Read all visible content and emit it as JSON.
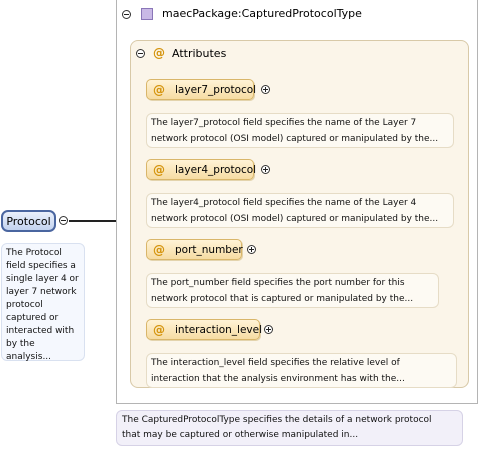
{
  "type": {
    "title": "maecPackage:CapturedProtocolType",
    "description": [
      "The CapturedProtocolType specifies the details of a network protocol",
      "that may be captured or otherwise manipulated in..."
    ]
  },
  "attributes": {
    "title": "Attributes",
    "items": [
      {
        "name": "layer7_protocol",
        "desc": [
          "The layer7_protocol field specifies the name of the Layer 7",
          "network protocol (OSI model) captured or manipulated by the..."
        ]
      },
      {
        "name": "layer4_protocol",
        "desc": [
          "The layer4_protocol field specifies the name of the Layer 4",
          "network protocol (OSI model) captured or manipulated by the..."
        ]
      },
      {
        "name": "port_number",
        "desc": [
          "The port_number field specifies the port number for this",
          "network protocol that is captured or manipulated by the..."
        ]
      },
      {
        "name": "interaction_level",
        "desc": [
          "The interaction_level field specifies the relative level of",
          "interaction that the analysis environment has with the..."
        ]
      }
    ]
  },
  "element": {
    "name": "Protocol",
    "description": [
      "The Protocol",
      "field specifies a",
      "single layer 4 or",
      "layer 7 network",
      "protocol",
      "captured or",
      "interacted with",
      "by the analysis..."
    ]
  },
  "icons": {
    "at_symbol": "@",
    "type_icon": "complex-type-icon"
  }
}
